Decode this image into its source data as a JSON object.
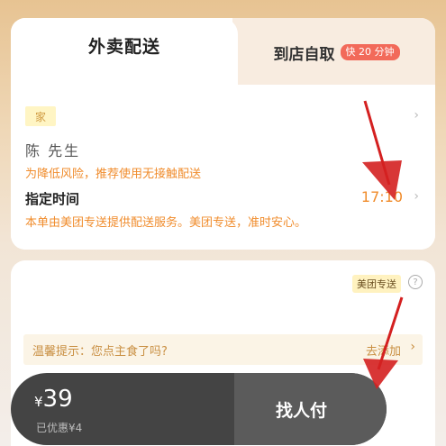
{
  "tabs": {
    "delivery_label": "外卖配送",
    "pickup_label": "到店自取",
    "pickup_badge": "快 20 分钟"
  },
  "address": {
    "tag": "家",
    "contact": "陈 先生",
    "safety_hint": "为降低风险，推荐使用无接触配送"
  },
  "schedule": {
    "label": "指定时间",
    "time": "17:10",
    "service_note": "本单由美团专送提供配送服务。美团专送，准时安心。"
  },
  "delivery_info": {
    "provider_tag": "美团专送",
    "help_icon": "?"
  },
  "tip": {
    "text": "温馨提示：您点主食了吗?",
    "action": "去添加"
  },
  "checkout": {
    "currency": "¥",
    "amount": "39",
    "discount_text": "已优惠¥4",
    "pay_label": "找人付"
  },
  "icons": {
    "chevron": "›"
  },
  "colors": {
    "accent_orange": "#f08c2c",
    "badge_red": "#f26a5a",
    "annotation_red": "#d42020",
    "checkout_dark": "#444444"
  }
}
